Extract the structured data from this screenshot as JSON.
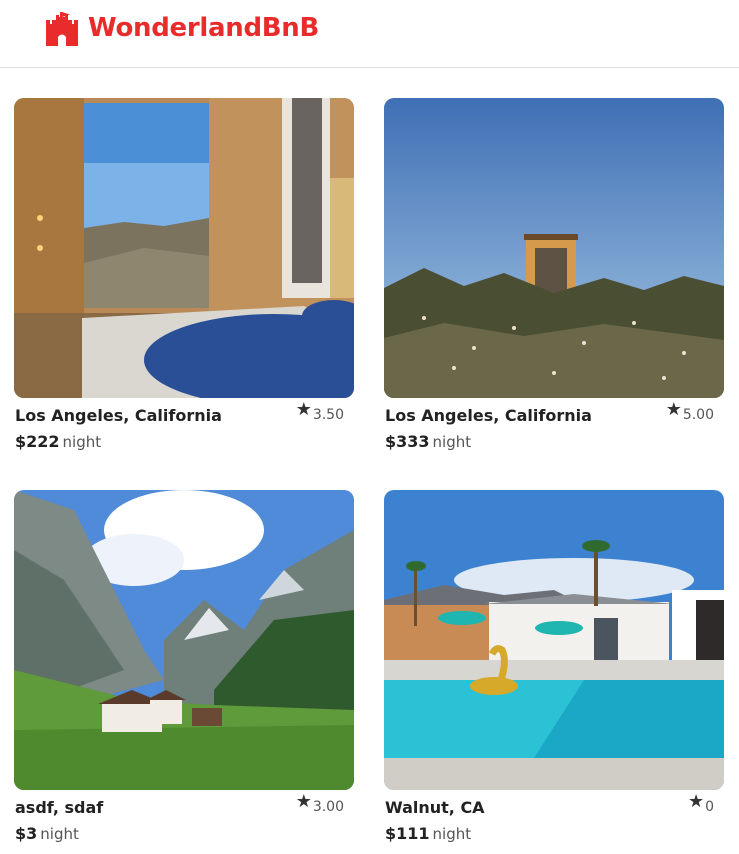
{
  "brand": {
    "name": "WonderlandBnB",
    "logo_icon": "castle-icon",
    "color": "#ea2b2b"
  },
  "listings": [
    {
      "location": "Los Angeles, California",
      "rating": "3.50",
      "price": "$222",
      "price_unit": "night",
      "star_icon": "star-icon"
    },
    {
      "location": "Los Angeles, California",
      "rating": "5.00",
      "price": "$333",
      "price_unit": "night",
      "star_icon": "star-icon"
    },
    {
      "location": "asdf, sdaf",
      "rating": "3.00",
      "price": "$3",
      "price_unit": "night",
      "star_icon": "star-icon"
    },
    {
      "location": "Walnut, CA",
      "rating": "0",
      "price": "$111",
      "price_unit": "night",
      "star_icon": "star-icon"
    }
  ]
}
